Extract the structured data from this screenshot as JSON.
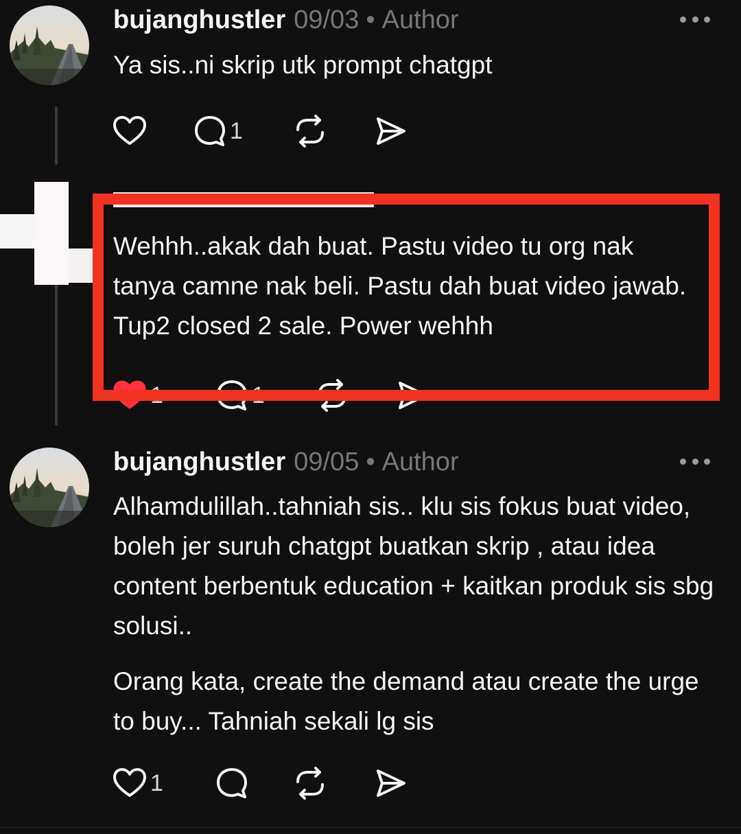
{
  "comments": [
    {
      "username": "bujanghustler",
      "date": "09/03",
      "separator": "•",
      "role": "Author",
      "text": "Ya sis..ni skrip utk prompt chatgpt",
      "likes": "",
      "replies": "1"
    },
    {
      "text": "Wehhh..akak dah buat. Pastu video tu org nak tanya camne nak beli. Pastu dah buat video jawab. Tup2 closed 2 sale. Power wehhh",
      "likes": "1",
      "replies": "1",
      "liked": true
    },
    {
      "username": "bujanghustler",
      "date": "09/05",
      "separator": "•",
      "role": "Author",
      "text_p1": "Alhamdulillah..tahniah sis.. klu sis fokus buat video, boleh jer suruh chatgpt buatkan skrip , atau idea content berbentuk education + kaitkan produk sis sbg solusi..",
      "text_p2": "Orang kata, create the demand atau create the urge to buy... Tahniah sekali lg sis",
      "likes": "1",
      "replies": ""
    }
  ],
  "colors": {
    "background": "#101010",
    "text": "#f3f5f7",
    "muted": "#777777",
    "highlight": "#f2311e",
    "like_red": "#ff3040"
  },
  "icons": [
    "heart-icon",
    "comment-icon",
    "repost-icon",
    "share-icon",
    "more-icon"
  ]
}
